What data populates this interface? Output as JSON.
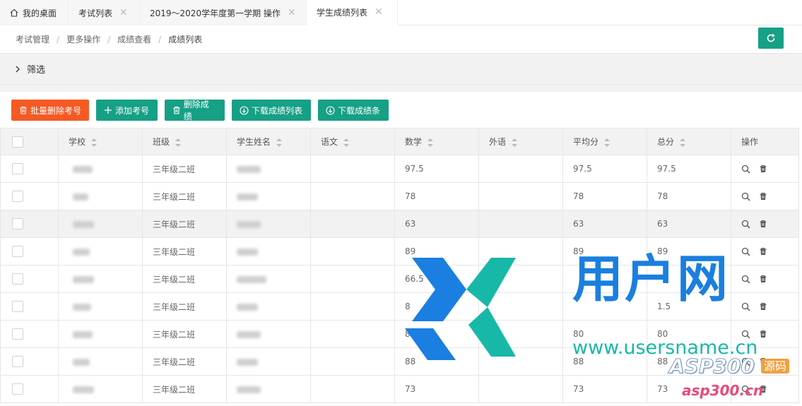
{
  "tabs": [
    {
      "label": "我的桌面",
      "home": true,
      "active": false
    },
    {
      "label": "考试列表",
      "active": false,
      "closable": true
    },
    {
      "label": "2019～2020学年度第一学期 操作",
      "active": false,
      "closable": true
    },
    {
      "label": "学生成绩列表",
      "active": true,
      "closable": true
    }
  ],
  "breadcrumb": [
    "考试管理",
    "更多操作",
    "成绩查看",
    "成绩列表"
  ],
  "filter_label": "筛选",
  "toolbar": {
    "batch_delete": "批量删除考号",
    "add_exam_no": "添加考号",
    "delete_scores": "删除成绩",
    "download_list": "下载成绩列表",
    "download_slip": "下载成绩条"
  },
  "table": {
    "headers": [
      "学校",
      "班级",
      "学生姓名",
      "语文",
      "数学",
      "外语",
      "平均分",
      "总分",
      "操作"
    ],
    "rows": [
      {
        "class": "三年级二班",
        "math": "97.5",
        "avg": "97.5",
        "total": "97.5"
      },
      {
        "class": "三年级二班",
        "math": "78",
        "avg": "78",
        "total": "78"
      },
      {
        "class": "三年级二班",
        "math": "63",
        "avg": "63",
        "total": "63"
      },
      {
        "class": "三年级二班",
        "math": "89",
        "avg": "89",
        "total": "89"
      },
      {
        "class": "三年级二班",
        "math": "66.5",
        "avg": "",
        "total": ""
      },
      {
        "class": "三年级二班",
        "math": "8",
        "avg": "",
        "total": "1.5"
      },
      {
        "class": "三年级二班",
        "math": "80",
        "avg": "80",
        "total": "80"
      },
      {
        "class": "三年级二班",
        "math": "88",
        "avg": "88",
        "total": "88"
      },
      {
        "class": "三年级二班",
        "math": "73",
        "avg": "73",
        "total": "73"
      }
    ]
  },
  "watermark": {
    "brand": "用户网",
    "url": "www.usersname.cn",
    "asp_badge": "ASP300",
    "asp_tag": "源码",
    "asp_url": "asp300.cn"
  },
  "colors": {
    "green": "#16a086",
    "orange": "#f55a24",
    "wm_blue": "#1a7fe0",
    "wm_teal": "#18b8a8"
  }
}
